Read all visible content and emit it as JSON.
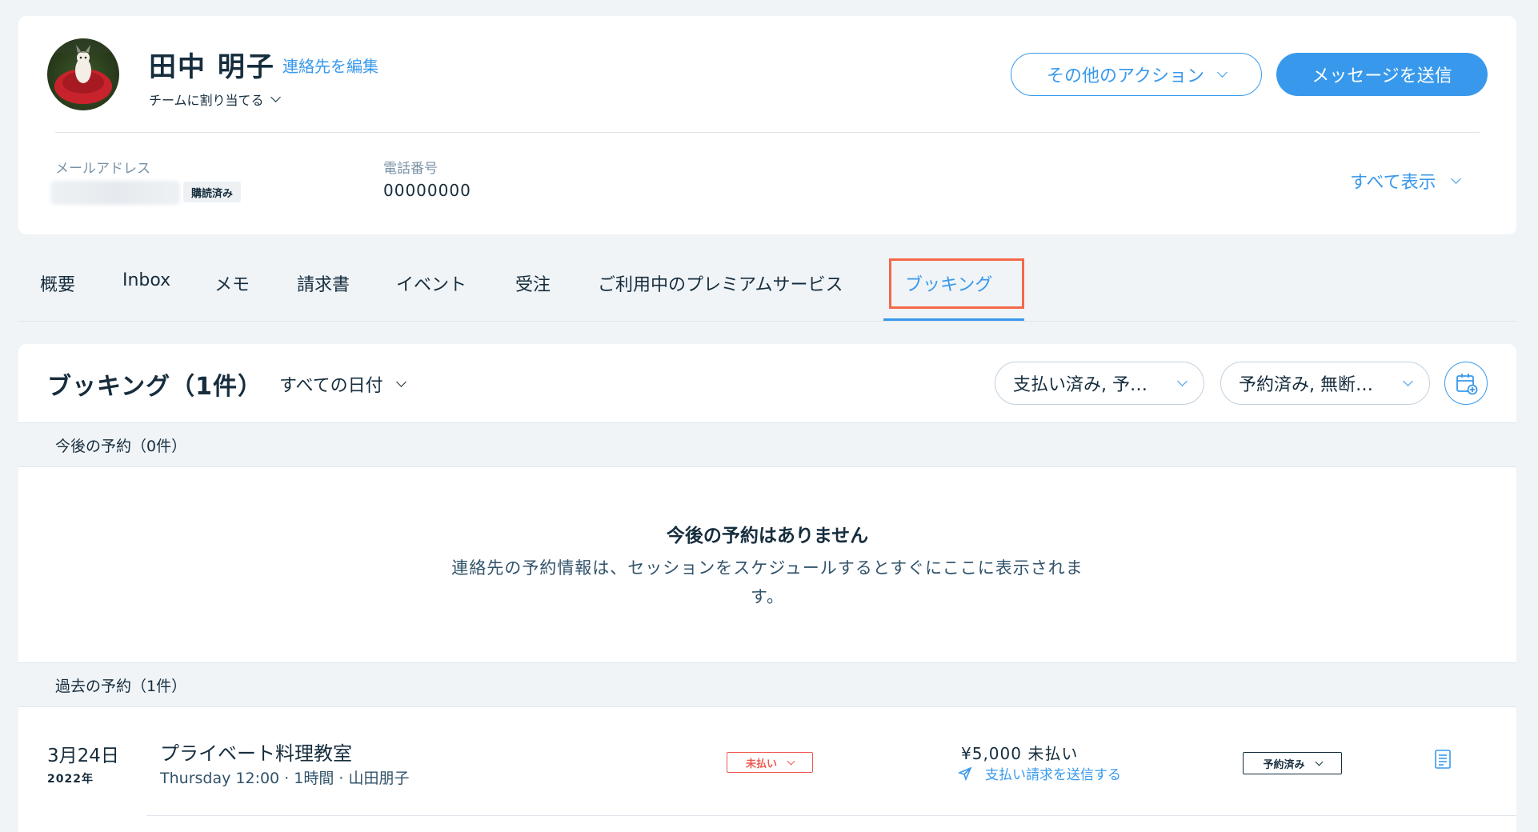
{
  "contact": {
    "name": "田中 明子",
    "edit_label": "連絡先を編集",
    "assign_team_label": "チームに割り当てる"
  },
  "actions": {
    "more_actions_label": "その他のアクション",
    "send_message_label": "メッセージを送信"
  },
  "fields": {
    "email_label": "メールアドレス",
    "email_status": "購読済み",
    "phone_label": "電話番号",
    "phone_value": "00000000",
    "show_all_label": "すべて表示"
  },
  "tabs": [
    {
      "label": "概要"
    },
    {
      "label": "Inbox"
    },
    {
      "label": "メモ"
    },
    {
      "label": "請求書"
    },
    {
      "label": "イベント"
    },
    {
      "label": "受注"
    },
    {
      "label": "ご利用中のプレミアムサービス"
    },
    {
      "label": "ブッキング",
      "active": true
    }
  ],
  "bookings": {
    "title": "ブッキング（1件）",
    "date_filter": "すべての日付",
    "payment_filter": "支払い済み, 予約済み",
    "status_filter": "予約済み, 無断キャンセル",
    "upcoming_header": "今後の予約（0件）",
    "empty_title": "今後の予約はありません",
    "empty_desc": "連絡先の予約情報は、セッションをスケジュールするとすぐにここに表示されます。",
    "past_header": "過去の予約（1件）",
    "rows": [
      {
        "date": "3月24日",
        "year": "2022年",
        "service": "プライベート料理教室",
        "detail": "Thursday 12:00 · 1時間 · 山田朋子",
        "payment_status": "未払い",
        "amount": "¥5,000 未払い",
        "send_request": "支払い請求を送信する",
        "booking_status": "予約済み"
      }
    ]
  },
  "colors": {
    "accent": "#3899ec",
    "text": "#162d3d",
    "danger": "#ee5951",
    "highlight": "#f4694a",
    "background": "#f0f4f7"
  }
}
